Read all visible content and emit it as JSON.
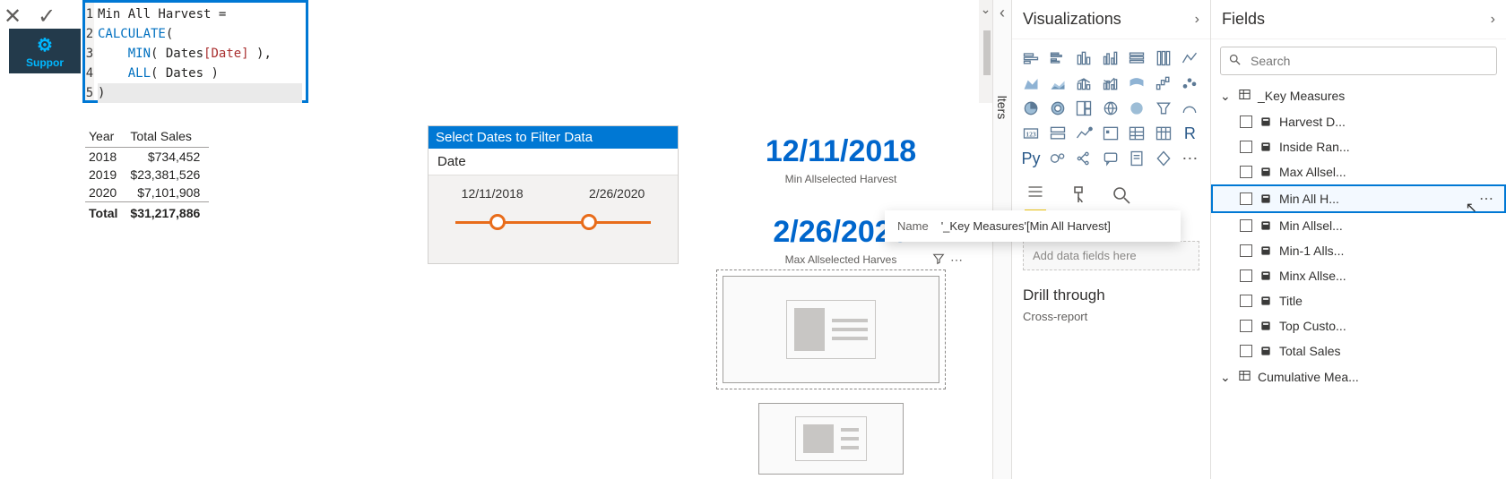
{
  "formula": {
    "lines": [
      "1",
      "2",
      "3",
      "4",
      "5"
    ],
    "text1": "Min All Harvest =",
    "text2": "CALCULATE",
    "text2b": "(",
    "text3a": "    ",
    "text3b": "MIN",
    "text3c": "( Dates",
    "text3d": "[Date]",
    "text3e": " ),",
    "text4a": "    ",
    "text4b": "ALL",
    "text4c": "( Dates )",
    "text5": ")"
  },
  "brand": {
    "label": "Suppor"
  },
  "filters_strip": {
    "label": "lters"
  },
  "table": {
    "headers": [
      "Year",
      "Total Sales"
    ],
    "rows": [
      [
        "2018",
        "$734,452"
      ],
      [
        "2019",
        "$23,381,526"
      ],
      [
        "2020",
        "$7,101,908"
      ]
    ],
    "total": [
      "Total",
      "$31,217,886"
    ]
  },
  "slicer": {
    "title": "Select Dates to Filter Data",
    "subtitle": "Date",
    "from": "12/11/2018",
    "to": "2/26/2020"
  },
  "card1": {
    "value": "12/11/2018",
    "caption": "Min Allselected Harvest"
  },
  "card2": {
    "value": "2/26/2020",
    "caption": "Max Allselected Harves"
  },
  "tooltip": {
    "key": "Name",
    "value": "'_Key Measures'[Min All Harvest]"
  },
  "viz_pane": {
    "title": "Visualizations",
    "icons": [
      "stacked-bar",
      "clustered-bar",
      "stacked-column",
      "clustered-column",
      "stacked-bar-100",
      "clustered-column-100",
      "line",
      "area",
      "stacked-area",
      "line-and-column",
      "line-and-clustered",
      "ribbon",
      "waterfall",
      "scatter",
      "pie",
      "donut",
      "treemap",
      "map",
      "filled-map",
      "funnel",
      "gauge",
      "card",
      "multi-row-card",
      "kpi",
      "slicer",
      "table",
      "matrix",
      "r",
      "py",
      "key-influencers",
      "decomposition",
      "qa",
      "paginated",
      "power-apps",
      "ellipsis"
    ],
    "section_fields": "Fields",
    "field_well_placeholder": "Add data fields here",
    "drill_title": "Drill through",
    "drill_sub": "Cross-report"
  },
  "fields_pane": {
    "title": "Fields",
    "search_placeholder": "Search",
    "groups": [
      {
        "name": "_Key Measures",
        "expanded": true,
        "items": [
          {
            "label": "Harvest D...",
            "selected": false
          },
          {
            "label": "Inside Ran...",
            "selected": false
          },
          {
            "label": "Max Allsel...",
            "selected": false
          },
          {
            "label": "Min All H...",
            "selected": true
          },
          {
            "label": "Min Allsel...",
            "selected": false
          },
          {
            "label": "Min-1 Alls...",
            "selected": false
          },
          {
            "label": "Minx Allse...",
            "selected": false
          },
          {
            "label": "Title",
            "selected": false
          },
          {
            "label": "Top Custo...",
            "selected": false
          },
          {
            "label": "Total Sales",
            "selected": false
          }
        ]
      },
      {
        "name": "Cumulative Mea...",
        "expanded": false,
        "items": []
      }
    ]
  }
}
